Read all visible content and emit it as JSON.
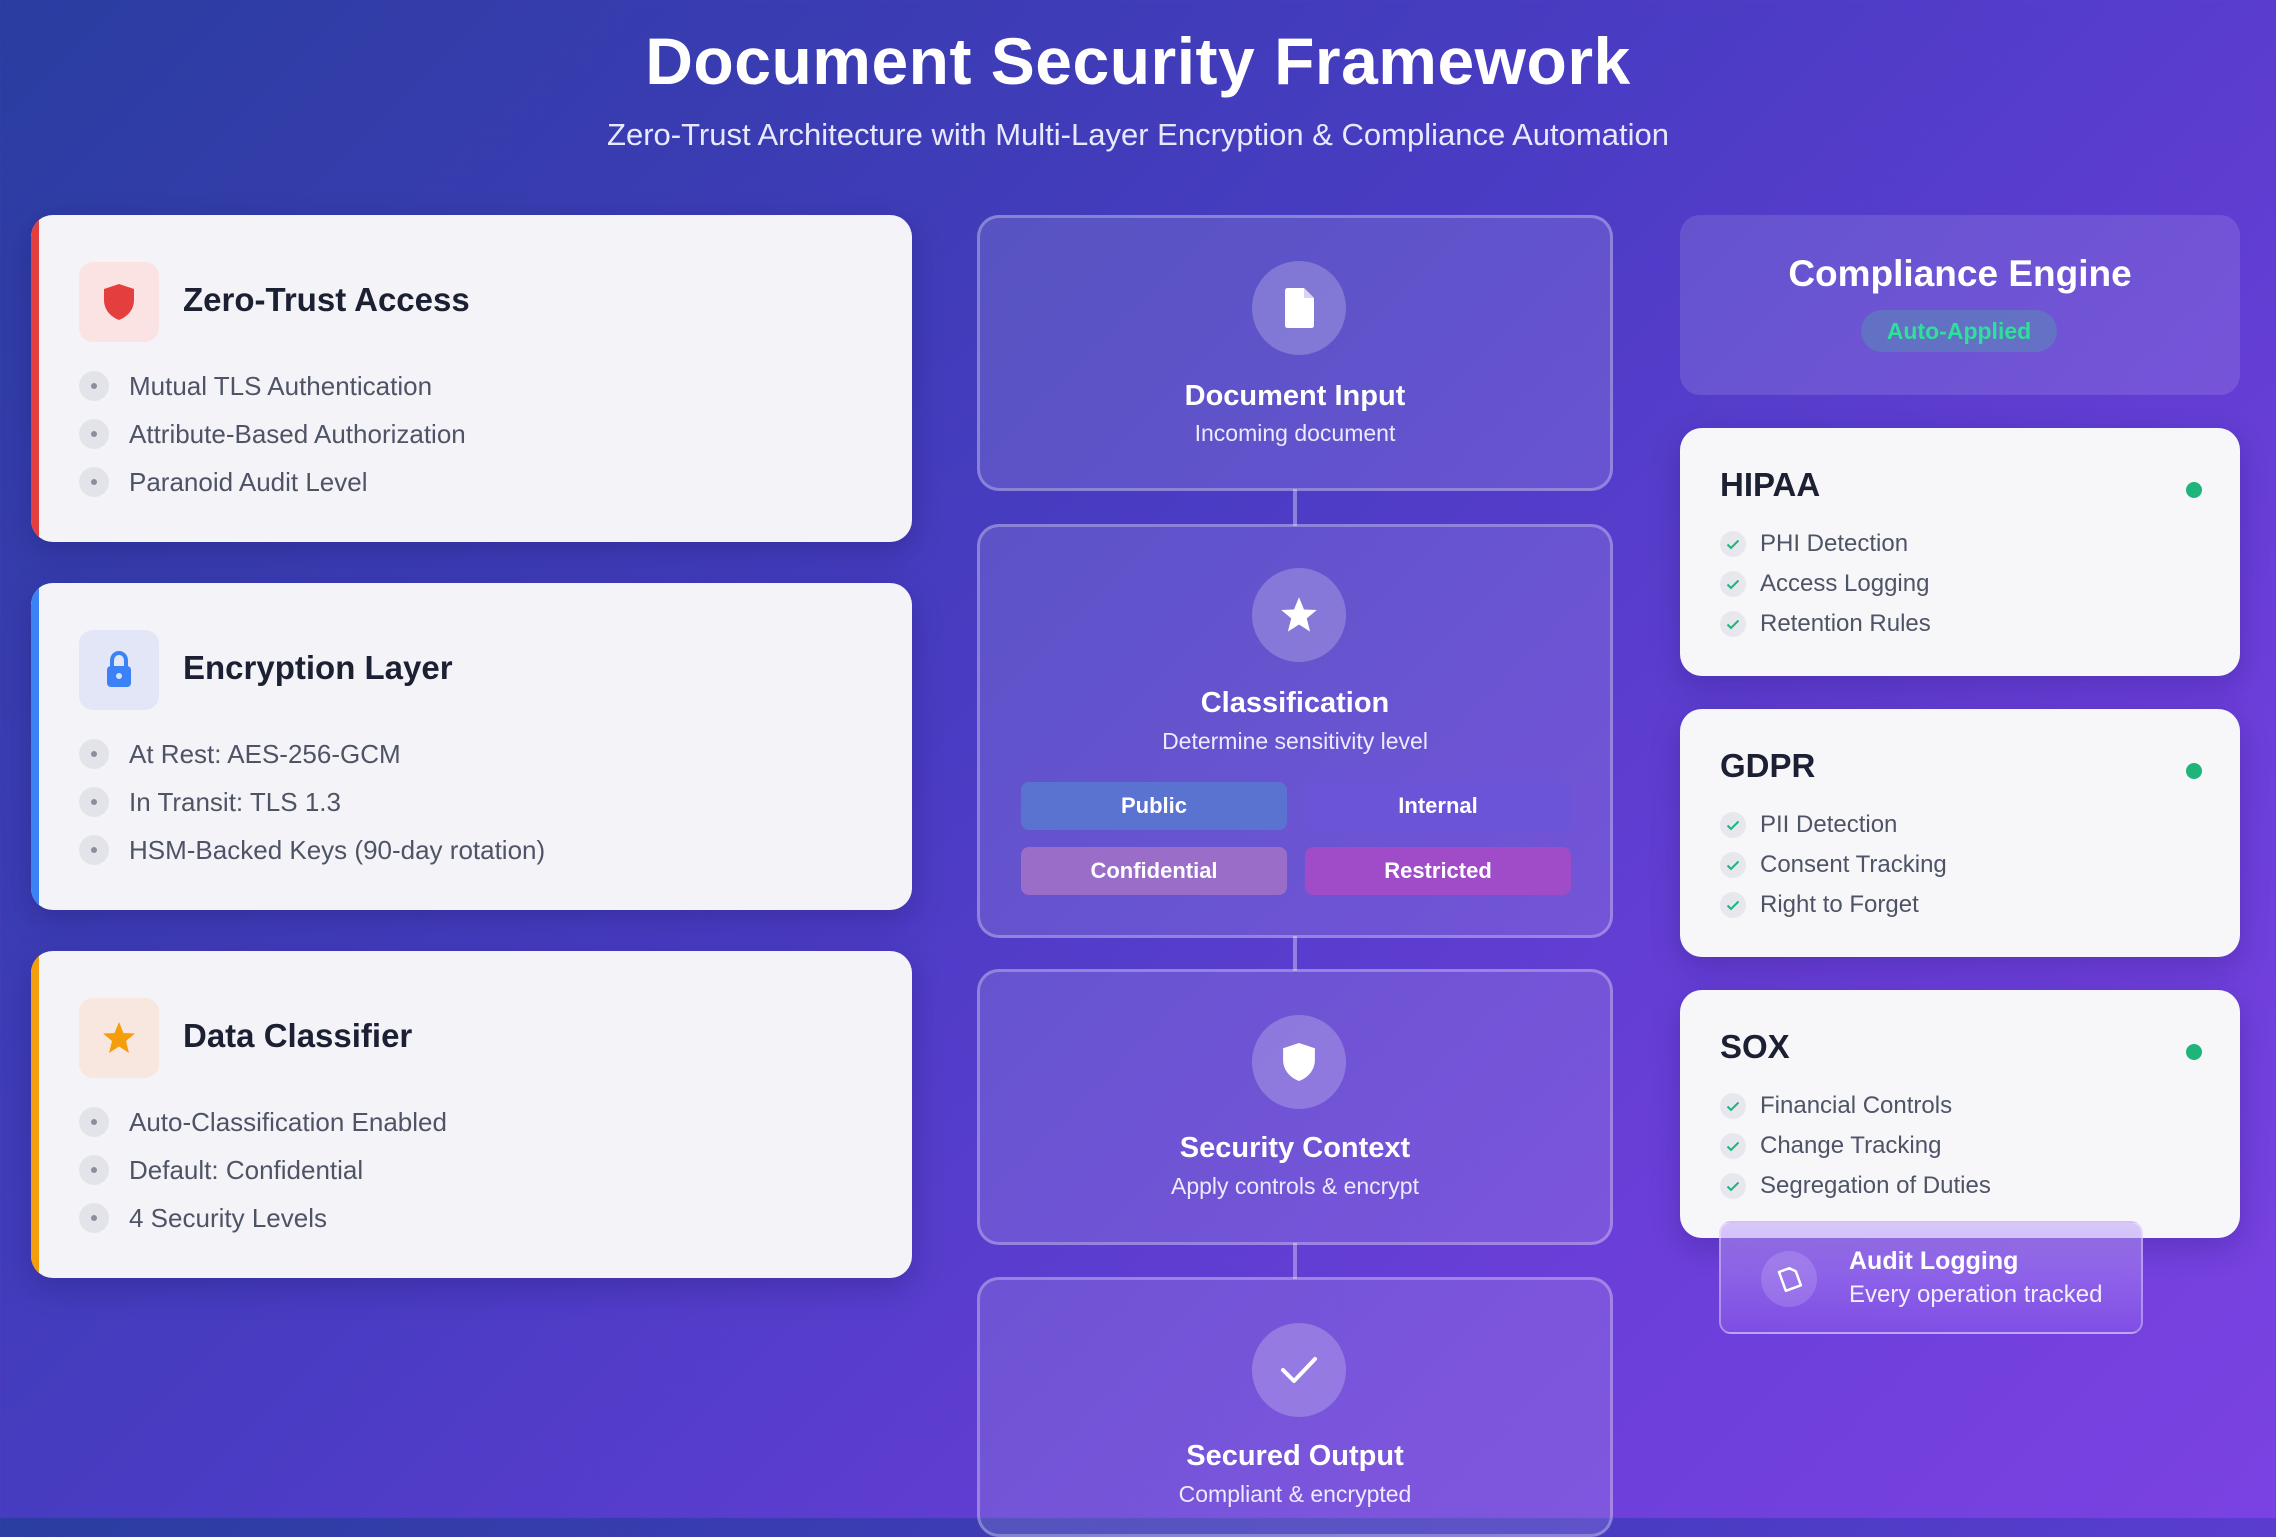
{
  "header": {
    "title": "Document Security Framework",
    "subtitle": "Zero-Trust Architecture with Multi-Layer Encryption & Compliance Automation"
  },
  "left_cards": [
    {
      "title": "Zero-Trust Access",
      "icon": "shield-icon",
      "accent": "#e53e3e",
      "items": [
        "Mutual TLS Authentication",
        "Attribute-Based Authorization",
        "Paranoid Audit Level"
      ]
    },
    {
      "title": "Encryption Layer",
      "icon": "lock-icon",
      "accent": "#3b82f6",
      "items": [
        "At Rest: AES-256-GCM",
        "In Transit: TLS 1.3",
        "HSM-Backed Keys (90-day rotation)"
      ]
    },
    {
      "title": "Data Classifier",
      "icon": "star-icon",
      "accent": "#f59e0b",
      "items": [
        "Auto-Classification Enabled",
        "Default: Confidential",
        "4 Security Levels"
      ]
    }
  ],
  "flow": [
    {
      "title": "Document Input",
      "subtitle": "Incoming document",
      "icon": "document-icon"
    },
    {
      "title": "Classification",
      "subtitle": "Determine sensitivity level",
      "icon": "star-icon",
      "levels": [
        "Public",
        "Internal",
        "Confidential",
        "Restricted"
      ]
    },
    {
      "title": "Security Context",
      "subtitle": "Apply controls & encrypt",
      "icon": "shield-icon"
    },
    {
      "title": "Secured Output",
      "subtitle": "Compliant & encrypted",
      "icon": "check-icon"
    }
  ],
  "compliance": {
    "title": "Compliance Engine",
    "badge": "Auto-Applied",
    "frameworks": [
      {
        "title": "HIPAA",
        "items": [
          "PHI Detection",
          "Access Logging",
          "Retention Rules"
        ]
      },
      {
        "title": "GDPR",
        "items": [
          "PII Detection",
          "Consent Tracking",
          "Right to Forget"
        ]
      },
      {
        "title": "SOX",
        "items": [
          "Financial Controls",
          "Change Tracking",
          "Segregation of Duties"
        ]
      }
    ],
    "status_color": "#1fb57a"
  },
  "audit": {
    "title": "Audit Logging",
    "subtitle": "Every operation tracked",
    "icon": "clipboard-icon"
  },
  "colors": {
    "level_public": "#5b73d0",
    "level_internal": "#6b54d8",
    "level_confidential": "#9a6ec8",
    "level_restricted": "#a04cc8"
  }
}
